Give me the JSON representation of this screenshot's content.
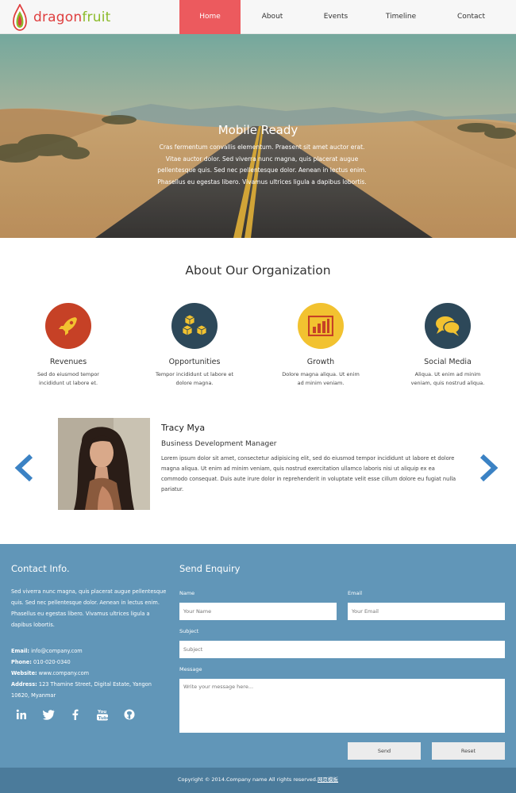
{
  "brand": {
    "part1": "dragon",
    "part2": "fruit",
    "color1": "#df3f3f",
    "color2": "#8cbb2b"
  },
  "nav": {
    "items": [
      {
        "label": "Home",
        "active": true
      },
      {
        "label": "About",
        "active": false
      },
      {
        "label": "Events",
        "active": false
      },
      {
        "label": "Timeline",
        "active": false
      },
      {
        "label": "Contact",
        "active": false
      }
    ],
    "accent": "#ec5a5e"
  },
  "hero": {
    "title": "Mobile Ready",
    "text": "Cras fermentum convallis elementum. Praesent sit amet auctor erat. Vitae auctor dolor. Sed viverra nunc magna, quis placerat augue pellentesque quis. Sed nec pellentesque dolor. Aenean in lectus enim. Phasellus eu egestas libero. Vivamus ultrices ligula a dapibus lobortis."
  },
  "about": {
    "title": "About Our Organization",
    "features": [
      {
        "title": "Revenues",
        "text": "Sed do eiusmod tempor incididunt ut labore et.",
        "icon": "rocket-icon",
        "color": "#c64126"
      },
      {
        "title": "Opportunities",
        "text": "Tempor incididunt ut labore et dolore magna.",
        "icon": "cubes-icon",
        "color": "#2d4859"
      },
      {
        "title": "Growth",
        "text": "Dolore magna aliqua. Ut enim ad minim veniam.",
        "icon": "bar-chart-icon",
        "color": "#f2c230"
      },
      {
        "title": "Social Media",
        "text": "Aliqua. Ut enim ad minim veniam, quis nostrud aliqua.",
        "icon": "chat-bubbles-icon",
        "color": "#2d4859"
      }
    ]
  },
  "testimonial": {
    "name": "Tracy Mya",
    "role": "Business Development Manager",
    "text": "Lorem ipsum dolor sit amet, consectetur adipisicing elit, sed do eiusmod tempor incididunt ut labore et dolore magna aliqua. Ut enim ad minim veniam, quis nostrud exercitation ullamco laboris nisi ut aliquip ex ea commodo consequat. Duis aute irure dolor in reprehenderit in voluptate velit esse cillum dolore eu fugiat nulla pariatur.",
    "arrow_color": "#3b82c4"
  },
  "contact": {
    "heading": "Contact Info.",
    "desc": "Sed viverra nunc magna, quis placerat augue pellentesque quis. Sed nec pellentesque dolor. Aenean in lectus enim. Phasellus eu egestas libero. Vivamus ultrices ligula a dapibus lobortis.",
    "email_label": "Email:",
    "email": "info@company.com",
    "phone_label": "Phone:",
    "phone": "010-020-0340",
    "website_label": "Website:",
    "website": "www.company.com",
    "address_label": "Address:",
    "address": "123 Thamine Street, Digital Estate, Yangon 10620, Myanmar",
    "socials": [
      "linkedin-icon",
      "twitter-icon",
      "facebook-icon",
      "youtube-icon",
      "github-icon"
    ]
  },
  "enquiry": {
    "heading": "Send Enquiry",
    "name_label": "Name",
    "name_placeholder": "Your Name",
    "email_label": "Email",
    "email_placeholder": "Your Email",
    "subject_label": "Subject",
    "subject_placeholder": "Subject",
    "message_label": "Message",
    "message_placeholder": "Write your message here...",
    "send_label": "Send",
    "reset_label": "Reset"
  },
  "footer": {
    "copyright": "Copyright © 2014.Company name All rights reserved.",
    "link": "网页模板"
  },
  "colors": {
    "footer_bg": "#6196b8",
    "footer_bottom": "#4b7b9b"
  }
}
